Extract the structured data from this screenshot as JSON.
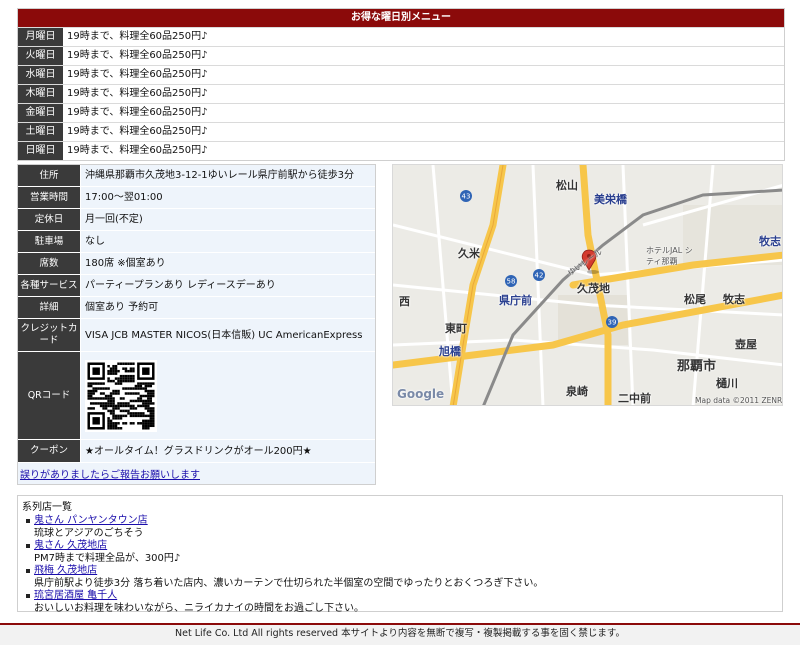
{
  "weekday_menu": {
    "title": "お得な曜日別メニュー",
    "rows": [
      {
        "day": "月曜日",
        "text": "19時まで、料理全60品250円♪"
      },
      {
        "day": "火曜日",
        "text": "19時まで、料理全60品250円♪"
      },
      {
        "day": "水曜日",
        "text": "19時まで、料理全60品250円♪"
      },
      {
        "day": "木曜日",
        "text": "19時まで、料理全60品250円♪"
      },
      {
        "day": "金曜日",
        "text": "19時まで、料理全60品250円♪"
      },
      {
        "day": "土曜日",
        "text": "19時まで、料理全60品250円♪"
      },
      {
        "day": "日曜日",
        "text": "19時まで、料理全60品250円♪"
      }
    ]
  },
  "info": {
    "address_label": "住所",
    "address": "沖縄県那覇市久茂地3-12-1ゆいレール県庁前駅から徒歩3分",
    "hours_label": "営業時間",
    "hours": "17:00～翌01:00",
    "holiday_label": "定休日",
    "holiday": "月一回(不定)",
    "parking_label": "駐車場",
    "parking": "なし",
    "seats_label": "席数",
    "seats": "180席 ※個室あり",
    "services_label": "各種サービス",
    "services": "パーティープランあり レディースデーあり",
    "details_label": "詳細",
    "details": "個室あり 予約可",
    "credit_label": "クレジットカード",
    "credit": "VISA JCB MASTER NICOS(日本信販) UC AmericanExpress",
    "qr_label": "QRコード",
    "coupon_label": "クーポン",
    "coupon": "★オールタイム！グラスドリンクがオール200円★",
    "report_link": "誤りがありましたらご報告お願いします"
  },
  "map": {
    "labels": {
      "matsuyama": "松山",
      "biei": "美栄橋",
      "kume": "久米",
      "kenchomae": "県庁前",
      "kumoji": "久茂地",
      "makishi": "牧志",
      "higashimachi": "東町",
      "asahibashi": "旭橋",
      "nishi": "西",
      "matsuo": "松尾",
      "naha_city": "那覇市",
      "tsuboya": "壺屋",
      "izumizaki": "泉崎",
      "futenma": "二中前",
      "hikawa": "樋川",
      "yui_rail": "ゆいレール",
      "hotel_jal": "ホテルJAL シティ那覇",
      "copyright": "Map data ©2011 ZENRIN",
      "google": "Google"
    },
    "colors": {
      "road_major": "#f7c64a",
      "road_minor": "#ffffff",
      "rail": "#8a8a8a",
      "marker": "#d43b2f"
    }
  },
  "sister": {
    "title": "系列店一覧",
    "items": [
      {
        "name": "鬼さん パンヤンタウン店",
        "desc": "琉球とアジアのごちそう"
      },
      {
        "name": "鬼さん 久茂地店",
        "desc": "PM7時まで料理全品が、300円♪"
      },
      {
        "name": "飛梅 久茂地店",
        "desc": "県庁前駅より徒歩3分 落ち着いた店内、濃いカーテンで仕切られた半個室の空間でゆったりとおくつろぎ下さい。"
      },
      {
        "name": "琉宮居酒屋 亀千人",
        "desc": "おいしいお料理を味わいながら、ニライカナイの時間をお過ごし下さい。"
      }
    ]
  },
  "footer": {
    "text": "Net Life Co. Ltd All rights reserved 本サイトより内容を無断で複写・複製掲載する事を固く禁じます。"
  }
}
